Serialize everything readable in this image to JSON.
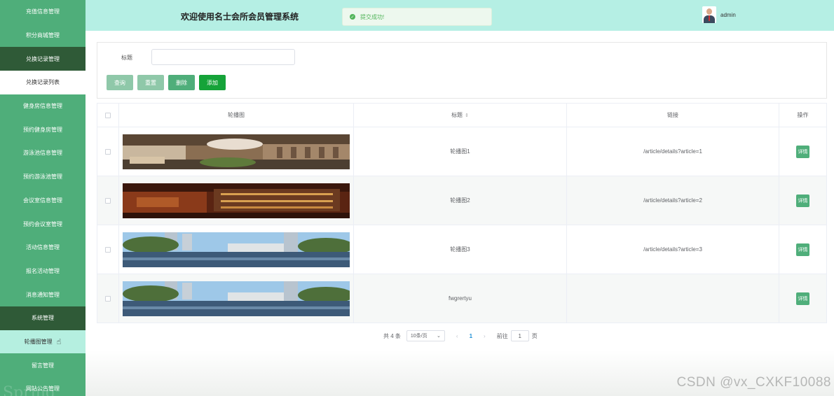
{
  "sidebar": {
    "items": [
      {
        "label": "充值信息管理",
        "style": "normal"
      },
      {
        "label": "积分商城管理",
        "style": "normal"
      },
      {
        "label": "兑换记录管理",
        "style": "dark"
      },
      {
        "label": "兑换记录列表",
        "style": "sub-white"
      },
      {
        "label": "健身房信息管理",
        "style": "normal"
      },
      {
        "label": "预约健身房管理",
        "style": "normal"
      },
      {
        "label": "游泳池信息管理",
        "style": "normal"
      },
      {
        "label": "预约游泳池管理",
        "style": "normal"
      },
      {
        "label": "会议室信息管理",
        "style": "normal"
      },
      {
        "label": "预约会议室管理",
        "style": "normal"
      },
      {
        "label": "活动信息管理",
        "style": "normal"
      },
      {
        "label": "报名活动管理",
        "style": "normal"
      },
      {
        "label": "消息通知管理",
        "style": "normal"
      },
      {
        "label": "系统管理",
        "style": "dark"
      },
      {
        "label": "轮播图管理",
        "style": "sub-mint"
      },
      {
        "label": "留言管理",
        "style": "normal"
      },
      {
        "label": "网站公告管理",
        "style": "normal"
      }
    ],
    "watermark": "Spring"
  },
  "header": {
    "title": "欢迎使用名士会所会员管理系统",
    "toast": "提交成功!",
    "user": "admin"
  },
  "search": {
    "label": "标题",
    "placeholder": "",
    "buttons": {
      "query": "查询",
      "reset": "重置",
      "delete": "删除",
      "add": "添加"
    }
  },
  "table": {
    "headers": {
      "image": "轮播图",
      "title": "标题",
      "link": "链接",
      "op": "操作"
    },
    "rows": [
      {
        "title": "轮播图1",
        "link": "/article/details?article=1",
        "action": "详情",
        "image": "lobby"
      },
      {
        "title": "轮播图2",
        "link": "/article/details?article=2",
        "action": "详情",
        "image": "bar"
      },
      {
        "title": "轮播图3",
        "link": "/article/details?article=3",
        "action": "详情",
        "image": "pool"
      },
      {
        "title": "fwgrertyu",
        "link": "",
        "action": "详情",
        "image": "pool"
      }
    ]
  },
  "pagination": {
    "total": "共 4 条",
    "page_size": "10条/页",
    "current": "1",
    "goto_label": "前往",
    "goto_value": "1",
    "page_suffix": "页",
    "prev": "‹",
    "next": "›"
  },
  "watermark": "CSDN @vx_CXKF10088"
}
